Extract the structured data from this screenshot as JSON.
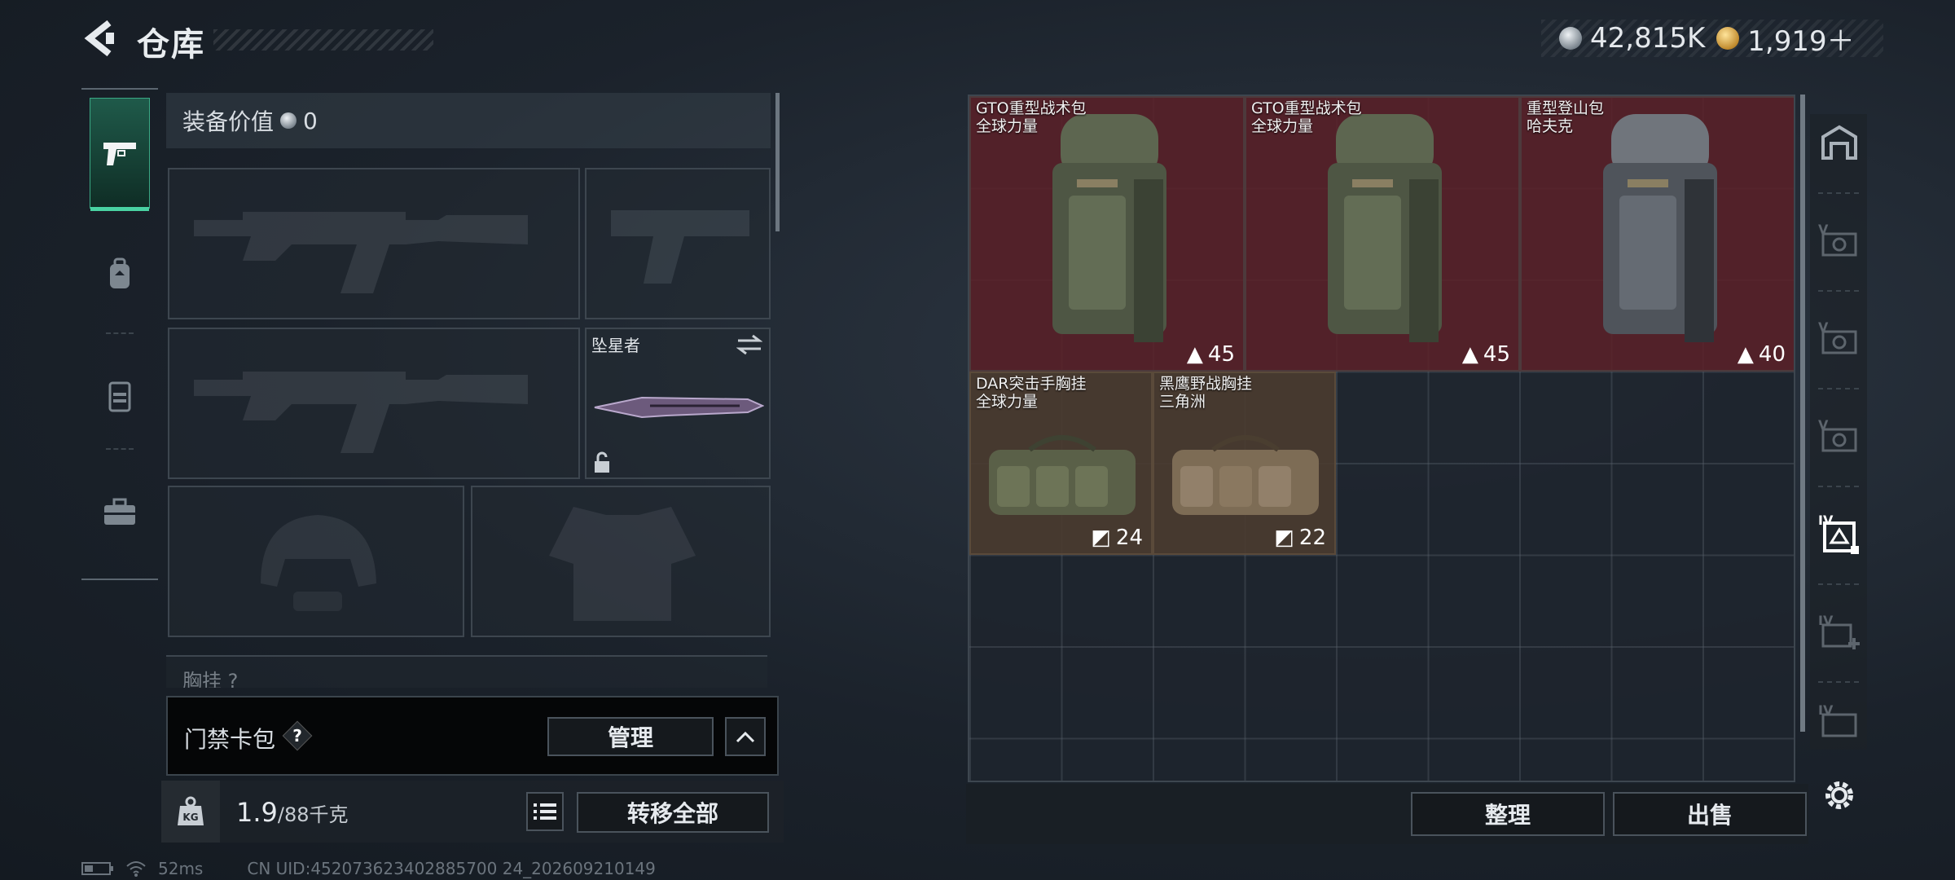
{
  "header": {
    "title": "仓库",
    "currencies": [
      {
        "icon": "silver-coin-icon",
        "value": "42,815K"
      },
      {
        "icon": "gold-coin-icon",
        "value": "1,919＋"
      }
    ]
  },
  "left_rail": {
    "items": [
      {
        "name": "weapons",
        "icon": "pistol-icon",
        "active": true
      },
      {
        "name": "backpack",
        "icon": "backpack-icon"
      },
      {
        "name": "vest",
        "icon": "vest-icon"
      },
      {
        "name": "case",
        "icon": "briefcase-icon"
      }
    ]
  },
  "loadout": {
    "value_label": "装备价值",
    "value_amount": "0",
    "melee_name": "坠星者",
    "partial_label": "胸挂 ?"
  },
  "keycard": {
    "label": "门禁卡包",
    "help": "?",
    "manage_label": "管理"
  },
  "bottom": {
    "weight_value": "1.9",
    "weight_max": "/88千克",
    "kg_label": "KG",
    "transfer_all_label": "转移全部"
  },
  "storage": {
    "items": [
      {
        "name": "GTO重型战术包",
        "brand": "全球力量",
        "capacity": "45",
        "kind": "backpack"
      },
      {
        "name": "GTO重型战术包",
        "brand": "全球力量",
        "capacity": "45",
        "kind": "backpack"
      },
      {
        "name": "重型登山包",
        "brand": "哈夫克",
        "capacity": "40",
        "kind": "backpack"
      },
      {
        "name": "DAR突击手胸挂",
        "brand": "全球力量",
        "capacity": "24",
        "kind": "vest"
      },
      {
        "name": "黑鹰野战胸挂",
        "brand": "三角洲",
        "capacity": "22",
        "kind": "vest"
      }
    ],
    "organize_label": "整理",
    "sell_label": "出售"
  },
  "right_rail": {
    "items": [
      {
        "icon": "vault-icon"
      },
      {
        "icon": "storage-v-icon",
        "label": "V"
      },
      {
        "icon": "storage-v-icon",
        "label": "V"
      },
      {
        "icon": "storage-v-icon",
        "label": "V"
      },
      {
        "icon": "storage-iv-icon",
        "label": "IV"
      },
      {
        "icon": "storage-add-icon",
        "label": "IV"
      },
      {
        "icon": "storage-iii-icon",
        "label": "IV"
      }
    ]
  },
  "status": {
    "ping": "52ms",
    "uid": "CN UID:452073623402885700 24_202609210149"
  },
  "colors": {
    "accent_green": "#49d3a2",
    "backpack_bg": "#5c2128",
    "vest_bg": "#4a3c30"
  }
}
